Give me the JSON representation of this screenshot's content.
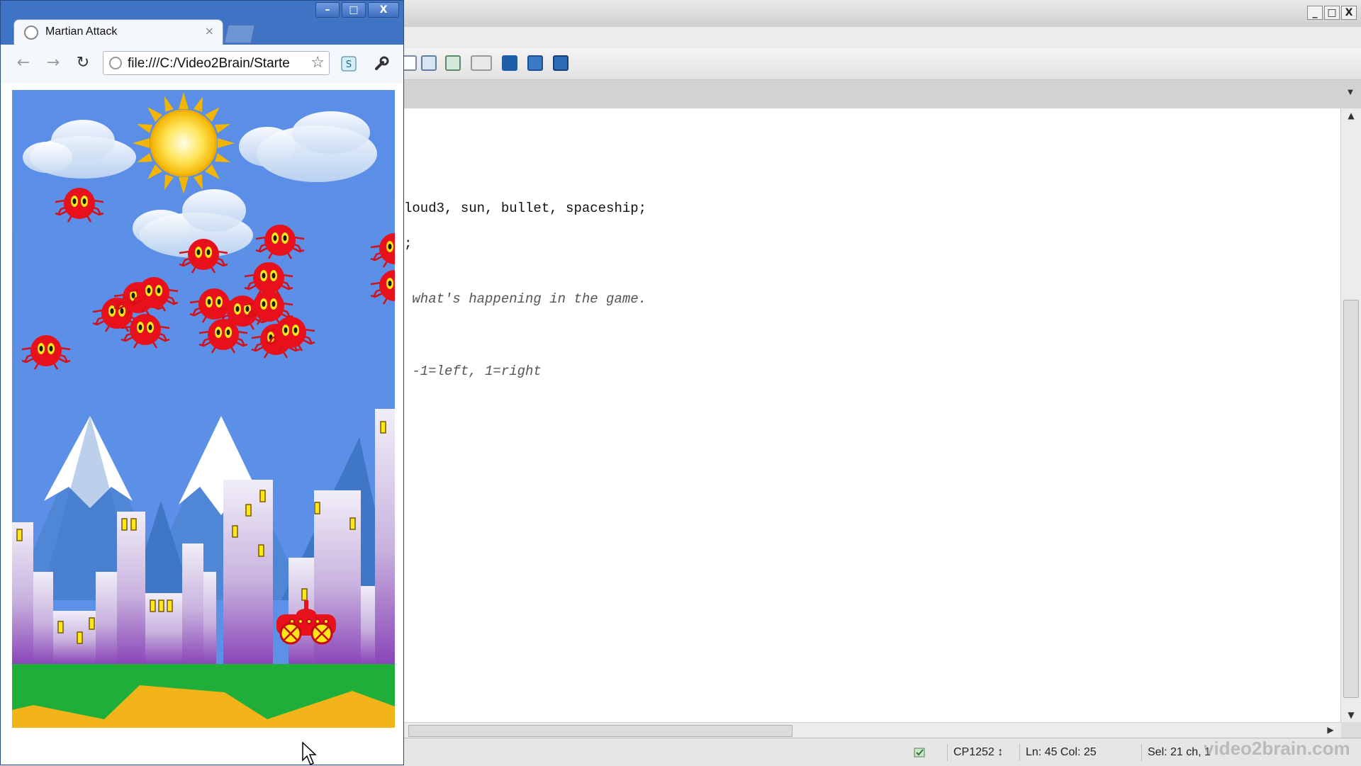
{
  "editor": {
    "window_buttons": [
      "_",
      "□",
      "X"
    ],
    "code_lines": [
      {
        "text": "loud3, sun, bullet, spaceship;",
        "comment": false
      },
      {
        "text": ";",
        "comment": false
      },
      {
        "text": " what's happening in the game.",
        "comment": true
      },
      {
        "text": " -1=left, 1=right",
        "comment": true
      }
    ],
    "status": {
      "encoding": "CP1252 ↕",
      "position": "Ln: 45 Col: 25",
      "selection": "Sel: 21 ch, 1",
      "watermark": "video2brain.com"
    }
  },
  "browser": {
    "window_buttons": [
      "–",
      "□",
      "X"
    ],
    "tab": {
      "title": "Martian Attack",
      "close": "×"
    },
    "url": "file:///C:/Video2Brain/Starte",
    "nav": {
      "back": "←",
      "forward": "→",
      "reload": "↻"
    },
    "icons": [
      "globe-icon",
      "star-icon",
      "wrench-icon",
      "extension-icon"
    ]
  },
  "game": {
    "colors": {
      "sky": "#5b8ee6",
      "grass": "#1fae3a",
      "sand": "#f2b418",
      "martian": "#e8101a",
      "sun": "#ffd21c"
    }
  }
}
